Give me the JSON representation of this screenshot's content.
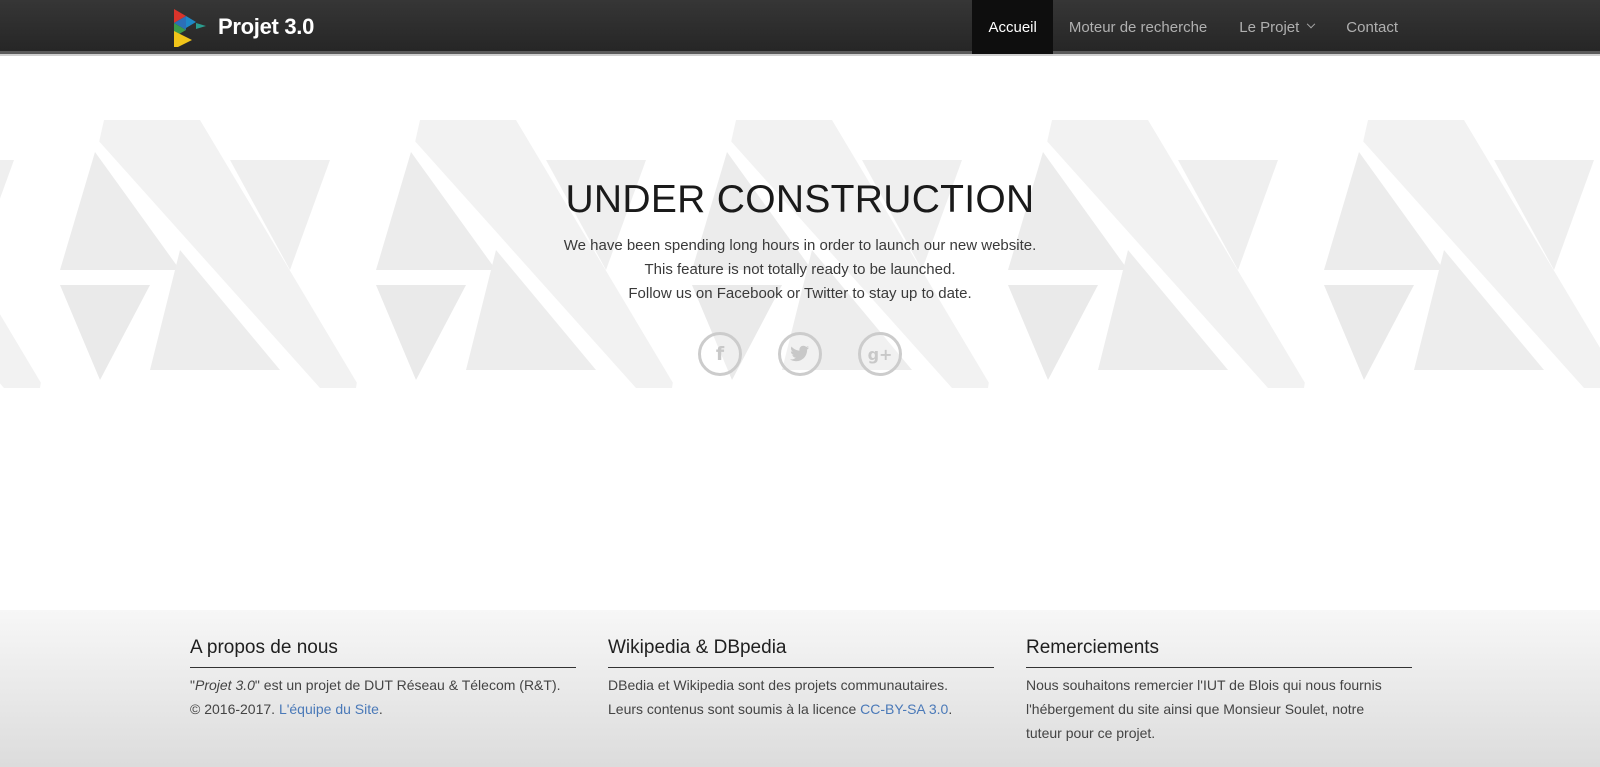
{
  "brand": {
    "name": "Projet 3.0",
    "logo_icon": "triangles-logo-icon"
  },
  "nav": {
    "items": [
      {
        "label": "Accueil",
        "active": true
      },
      {
        "label": "Moteur de recherche",
        "active": false
      },
      {
        "label": "Le Projet",
        "active": false,
        "dropdown": true
      },
      {
        "label": "Contact",
        "active": false
      }
    ]
  },
  "hero": {
    "title": "UNDER CONSTRUCTION",
    "lines": [
      "We have been spending long hours in order to launch our new website.",
      "This feature is not totally ready to be launched.",
      "Follow us on Facebook or Twitter to stay up to date."
    ],
    "social": [
      {
        "icon": "facebook-icon",
        "glyph": "f"
      },
      {
        "icon": "twitter-icon",
        "glyph": "t"
      },
      {
        "icon": "google-plus-icon",
        "glyph": "g+"
      }
    ]
  },
  "footer": {
    "about": {
      "title": "A propos de nous",
      "quote_open": "\"",
      "project_name": "Projet 3.0",
      "text_after": "\" est un projet de DUT Réseau & Télecom (R&T).",
      "copyright": "© 2016-2017. ",
      "team_link": "L'équipe du Site",
      "period": "."
    },
    "wiki": {
      "title": "Wikipedia & DBpedia",
      "line1": "DBedia et Wikipedia sont des projets communautaires.",
      "line2": "Leurs contenus sont soumis à la licence ",
      "license_link": "CC-BY-SA 3.0",
      "period": "."
    },
    "thanks": {
      "title": "Remerciements",
      "line1": "Nous souhaitons remercier l'IUT de Blois qui nous fournis",
      "line2": "l'hébergement du site ainsi que Monsieur Soulet, notre",
      "line3": "tuteur pour ce projet."
    }
  },
  "colors": {
    "navbar": "#2d2d2d",
    "active_tab": "#0e0e0e",
    "link": "#4a79b8"
  }
}
